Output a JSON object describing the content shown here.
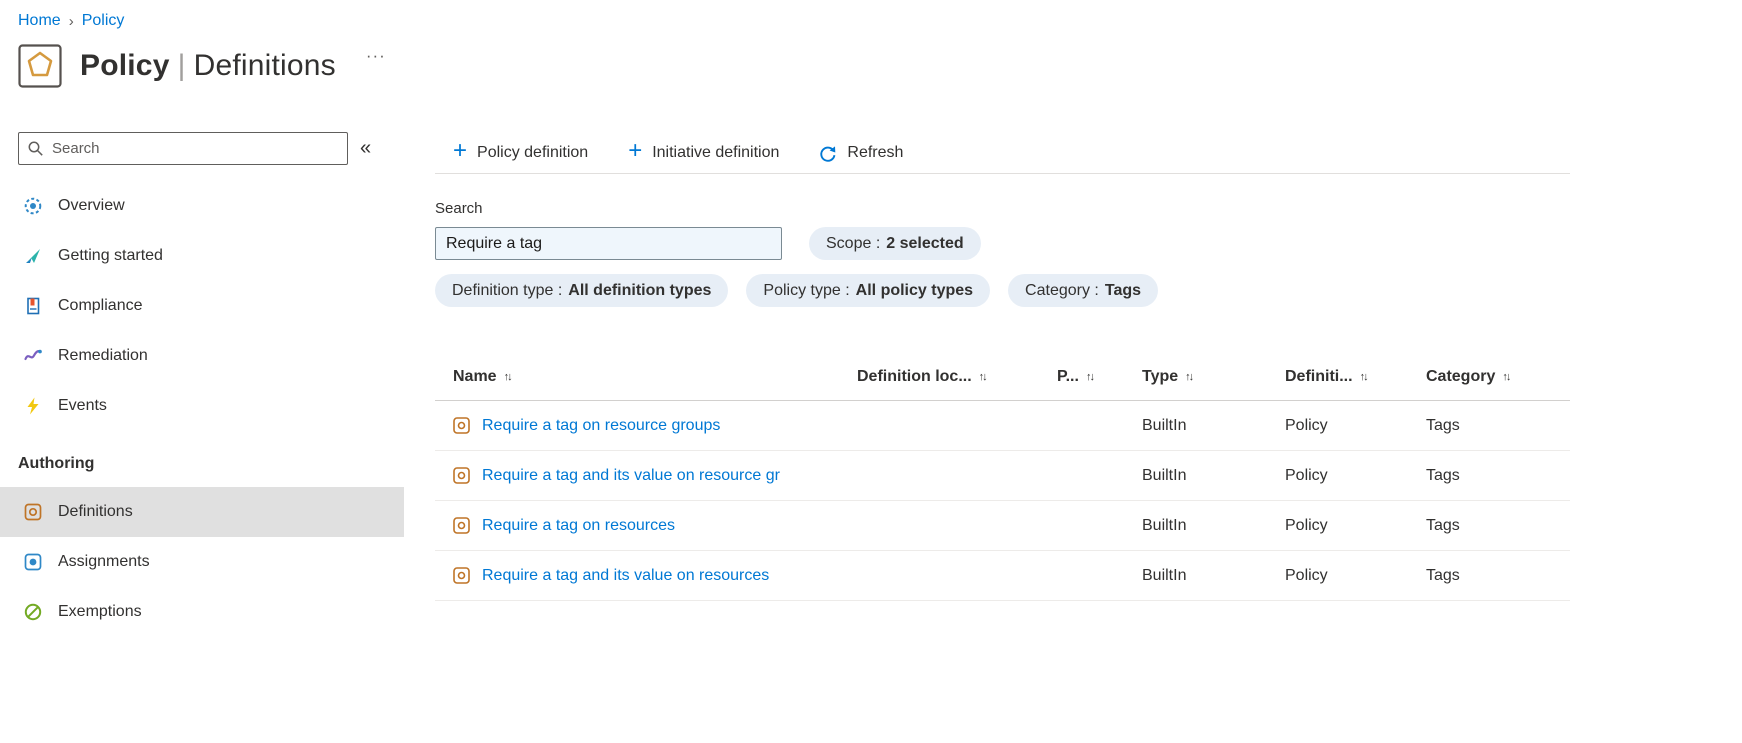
{
  "breadcrumb": {
    "items": [
      "Home",
      "Policy"
    ],
    "separator": "›"
  },
  "header": {
    "title_primary": "Policy",
    "title_separator": "|",
    "title_secondary": "Definitions",
    "more_label": "···"
  },
  "sidebar": {
    "search_placeholder": "Search",
    "collapse_label": "«",
    "items": [
      {
        "label": "Overview"
      },
      {
        "label": "Getting started"
      },
      {
        "label": "Compliance"
      },
      {
        "label": "Remediation"
      },
      {
        "label": "Events"
      }
    ],
    "section_label": "Authoring",
    "authoring_items": [
      {
        "label": "Definitions"
      },
      {
        "label": "Assignments"
      },
      {
        "label": "Exemptions"
      }
    ],
    "selected_item": "Definitions"
  },
  "toolbar": {
    "policy_definition_label": "Policy definition",
    "initiative_definition_label": "Initiative definition",
    "refresh_label": "Refresh"
  },
  "filters": {
    "search_label": "Search",
    "search_value": "Require a tag",
    "pills": [
      {
        "label": "Scope :",
        "value": "2 selected"
      },
      {
        "label": "Definition type :",
        "value": "All definition types"
      },
      {
        "label": "Policy type :",
        "value": "All policy types"
      },
      {
        "label": "Category :",
        "value": "Tags"
      }
    ]
  },
  "table": {
    "sort_icon": "↑↓",
    "columns": [
      "Name",
      "Definition loc...",
      "P...",
      "Type",
      "Definiti...",
      "Category"
    ],
    "rows": [
      {
        "name": "Require a tag on resource groups",
        "definition_location": "",
        "p": "",
        "type": "BuiltIn",
        "definition_type": "Policy",
        "category": "Tags"
      },
      {
        "name": "Require a tag and its value on resource gr",
        "definition_location": "",
        "p": "",
        "type": "BuiltIn",
        "definition_type": "Policy",
        "category": "Tags"
      },
      {
        "name": "Require a tag on resources",
        "definition_location": "",
        "p": "",
        "type": "BuiltIn",
        "definition_type": "Policy",
        "category": "Tags"
      },
      {
        "name": "Require a tag and its value on resources",
        "definition_location": "",
        "p": "",
        "type": "BuiltIn",
        "definition_type": "Policy",
        "category": "Tags"
      }
    ]
  },
  "colors": {
    "accent": "#0078d4",
    "link": "#0078d4",
    "text": "#323130",
    "pill_bg": "#e7eef6",
    "search_bg": "#eff6fc",
    "selected_bg": "#e0e0e0",
    "divider": "#edebe9",
    "policy_icon": "#bf7427"
  }
}
